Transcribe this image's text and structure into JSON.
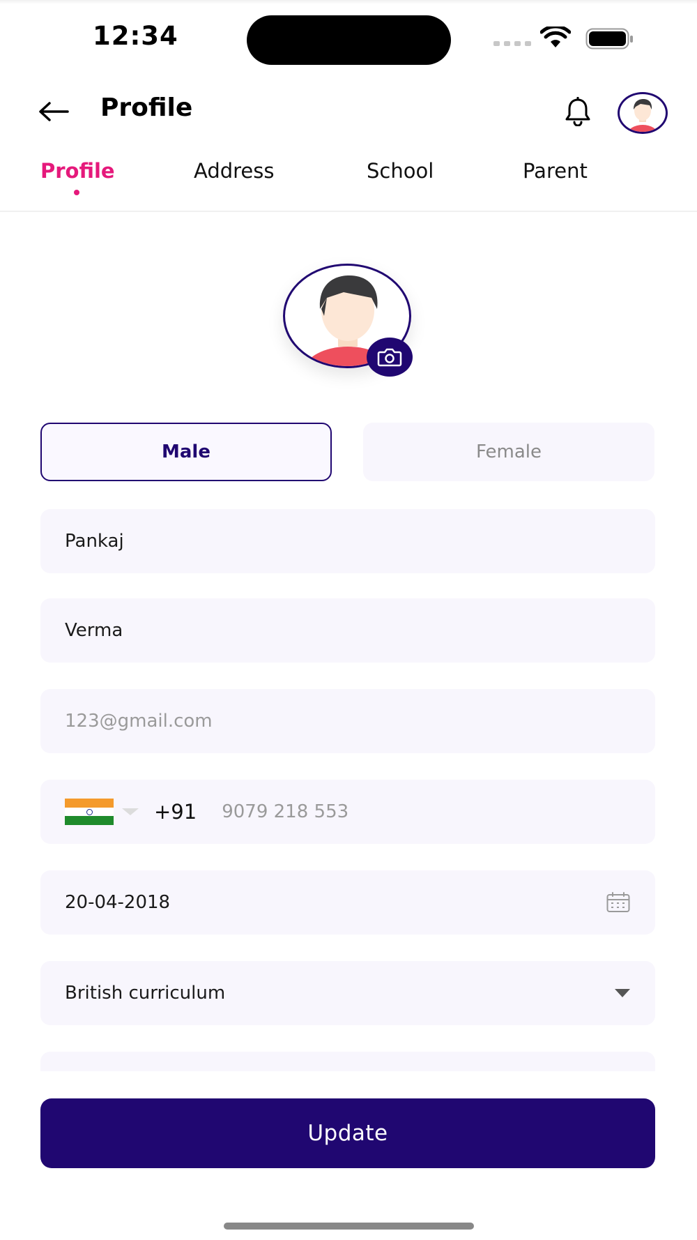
{
  "status_bar": {
    "time": "12:34"
  },
  "header": {
    "title": "Profile",
    "back_icon": "arrow-left-icon",
    "notification_icon": "bell-icon",
    "avatar_icon": "user-avatar"
  },
  "tabs": [
    {
      "label": "Profile",
      "active": true
    },
    {
      "label": "Address",
      "active": false
    },
    {
      "label": "School",
      "active": false
    },
    {
      "label": "Parent",
      "active": false
    }
  ],
  "profile_photo": {
    "camera_icon": "camera-icon"
  },
  "gender": {
    "male_label": "Male",
    "female_label": "Female",
    "selected": "Male"
  },
  "form": {
    "first_name": "Pankaj",
    "last_name": "Verma",
    "email_placeholder": "123@gmail.com",
    "phone": {
      "country_flag": "india-flag",
      "dial_code": "+91",
      "number_placeholder": "9079 218 553"
    },
    "date_of_birth": "20-04-2018",
    "curriculum": "British curriculum"
  },
  "actions": {
    "update_label": "Update"
  },
  "colors": {
    "primary": "#200771",
    "accent": "#e5197b",
    "field_bg": "#f8f6fd",
    "placeholder": "#9a9a9a"
  }
}
